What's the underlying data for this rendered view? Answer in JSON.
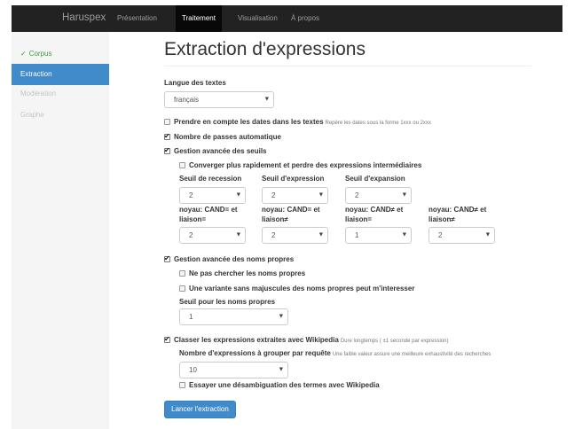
{
  "navbar": {
    "brand": "Haruspex",
    "items": [
      {
        "label": "Présentation"
      },
      {
        "label": "Traitement"
      },
      {
        "label": "Visualisation"
      },
      {
        "label": "À propos"
      }
    ]
  },
  "sidebar": {
    "items": [
      {
        "label": "Corpus",
        "state": "done"
      },
      {
        "label": "Extraction",
        "state": "active"
      },
      {
        "label": "Modération",
        "state": "disabled"
      },
      {
        "label": "Graphe",
        "state": "disabled"
      }
    ],
    "check_glyph": "✓"
  },
  "main": {
    "title": "Extraction d'expressions",
    "language": {
      "label": "Langue des textes",
      "value": "français"
    },
    "dates": {
      "label": "Prendre en compte les dates dans les textes",
      "help": "Repère les dates sous la forme 1xxx ou 2xxx",
      "checked": false
    },
    "passes": {
      "label": "Nombre de passes automatique",
      "checked": true
    },
    "thresholds": {
      "label": "Gestion avancée des seuils",
      "checked": true,
      "converge": {
        "label": "Converger plus rapidement et perdre des expressions intermédiaires",
        "checked": false
      },
      "seuil_recession": {
        "label": "Seuil de recession",
        "value": "2"
      },
      "seuil_expression": {
        "label": "Seuil d'expression",
        "value": "2"
      },
      "seuil_expansion": {
        "label": "Seuil d'expansion",
        "value": "2"
      },
      "noyau1": {
        "label_line1": "noyau: CAND= et",
        "label_line2": "liaison=",
        "value": "2"
      },
      "noyau2": {
        "label_line1": "noyau: CAND= et",
        "label_line2": "liaison≠",
        "value": "2"
      },
      "noyau3": {
        "label_line1": "noyau: CAND≠ et",
        "label_line2": "liaison=",
        "value": "1"
      },
      "noyau4": {
        "label_line1": "noyau: CAND≠ et",
        "label_line2": "liaison≠",
        "value": "2"
      }
    },
    "proper_names": {
      "label": "Gestion avancée des noms propres",
      "checked": true,
      "no_search": {
        "label": "Ne pas chercher les noms propres",
        "checked": false
      },
      "variant": {
        "label": "Une variante sans majuscules des noms propres peut m'interesser",
        "checked": false
      },
      "seuil": {
        "label": "Seuil pour les noms propres",
        "value": "1"
      }
    },
    "wikipedia": {
      "label": "Classer les expressions extraites avec Wikipedia",
      "help": "Dure longtemps ( ±1 seconde par expression)",
      "checked": true,
      "group": {
        "label": "Nombre d'expressions à grouper par requête",
        "help": "Une faible valeur assure une meilleure exhaustivité des recherches",
        "value": "10"
      },
      "disambiguation": {
        "label": "Essayer une désambiguation des termes avec Wikipedia",
        "checked": false
      }
    },
    "submit_label": "Lancer l'extraction"
  },
  "colors": {
    "primary": "#428bca",
    "navbar": "#222222",
    "sidebar": "#f5f5f5",
    "success": "#3c9a3c"
  },
  "icons": {
    "select_caret": "▼"
  }
}
